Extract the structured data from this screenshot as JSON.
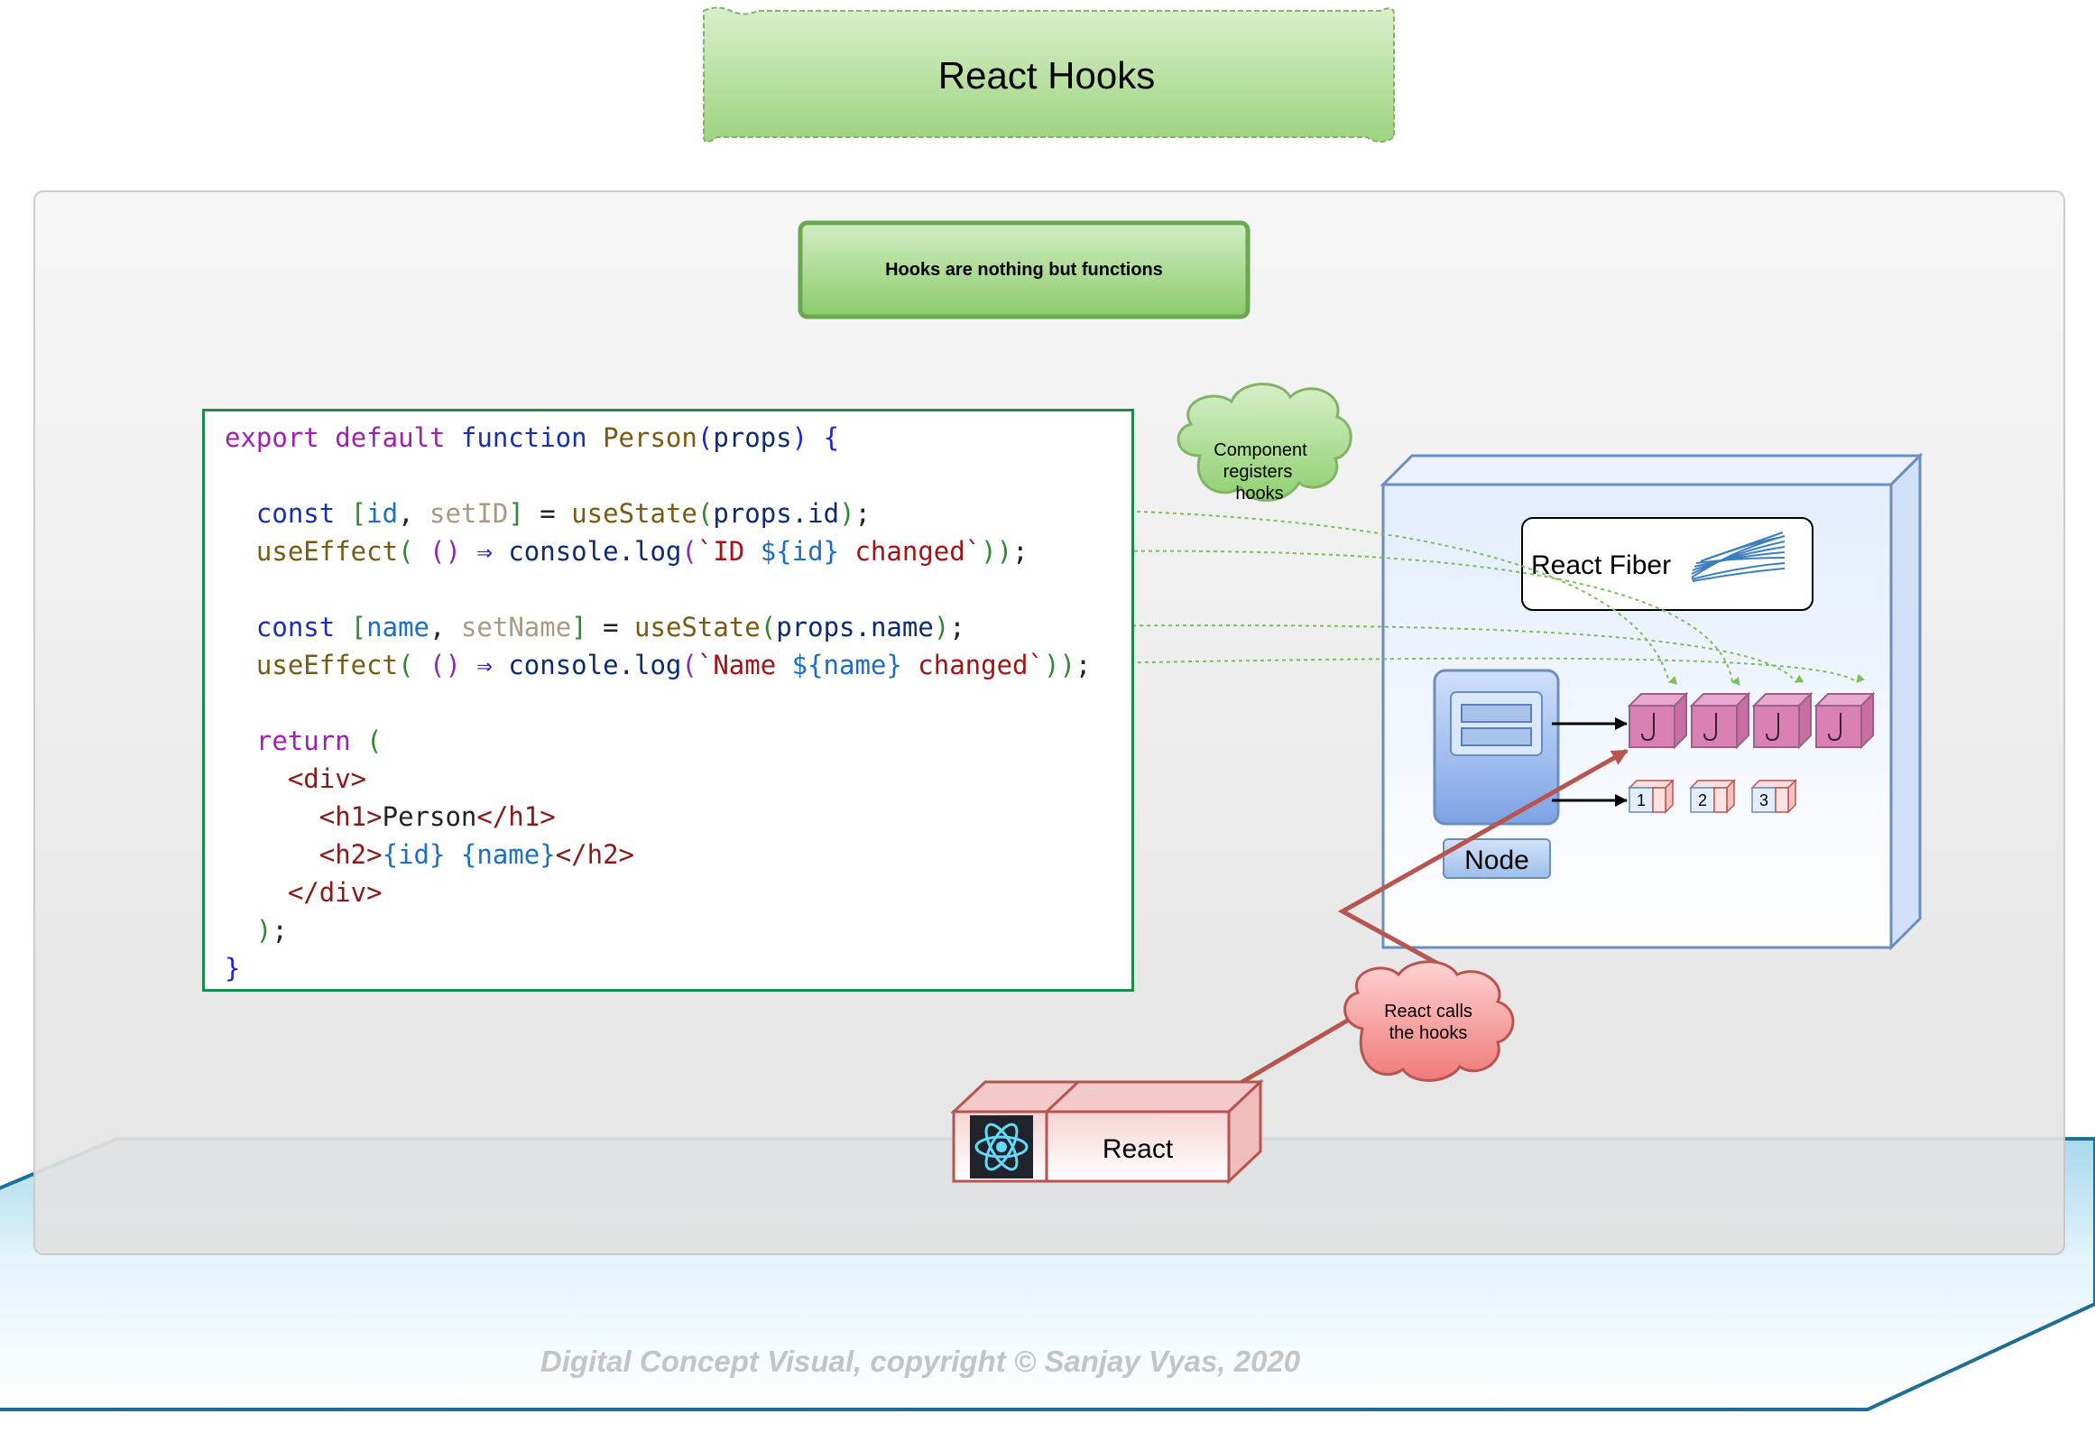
{
  "title": "React Hooks",
  "subtitle": "Hooks are nothing but functions",
  "code": {
    "line1": {
      "export": "export",
      "default": "default",
      "function": "function",
      "name": "Person",
      "open": "(",
      "arg": "props",
      "close": ")",
      "brace": "{"
    },
    "line2": {
      "const": "const",
      "b1": "[",
      "v1": "id",
      "comma": ",",
      "v2": "setID",
      "b2": "]",
      "eq": "=",
      "fn": "useState",
      "p1": "(",
      "arg": "props.id",
      "p2": ")",
      "semi": ";"
    },
    "line3": {
      "fn": "useEffect",
      "p1": "(",
      "params": "()",
      "arrow": "⇒",
      "obj": "console.log",
      "p2": "(",
      "s1": "`ID ",
      "t1": "${id}",
      "s2": " changed`",
      "p3": "))",
      "semi": ";"
    },
    "line4": {
      "const": "const",
      "b1": "[",
      "v1": "name",
      "comma": ",",
      "v2": "setName",
      "b2": "]",
      "eq": "=",
      "fn": "useState",
      "p1": "(",
      "arg": "props.name",
      "p2": ")",
      "semi": ";"
    },
    "line5": {
      "fn": "useEffect",
      "p1": "(",
      "params": "()",
      "arrow": "⇒",
      "obj": "console.log",
      "p2": "(",
      "s1": "`Name ",
      "t1": "${name}",
      "s2": " changed`",
      "p3": "))",
      "semi": ";"
    },
    "line6": {
      "kw": "return",
      "p": "("
    },
    "line7": {
      "tag": "<div>"
    },
    "line8": {
      "o": "<h1>",
      "text": "Person",
      "c": "</h1>"
    },
    "line9": {
      "o": "<h2>",
      "e1": "{id}",
      "e2": "{name}",
      "c": "</h2>"
    },
    "line10": {
      "tag": "</div>"
    },
    "line11": {
      "p": ")",
      "semi": ";"
    },
    "line12": {
      "brace": "}"
    }
  },
  "cloud_component": [
    "Component",
    "registers",
    "hooks"
  ],
  "cloud_react": [
    "React calls",
    "the hooks"
  ],
  "fiber_label": "React Fiber",
  "node_label": "Node",
  "react_label": "React",
  "state_cells": [
    "1",
    "2",
    "3"
  ],
  "footer": "Digital Concept Visual, copyright © Sanjay Vyas, 2020",
  "colors": {
    "title_green": "#a7d98b",
    "hook_block": "#d980b4",
    "react_red": "#f3b6b6",
    "fiber_box": "#dbe8fb",
    "code_border": "#1b8a4a"
  }
}
